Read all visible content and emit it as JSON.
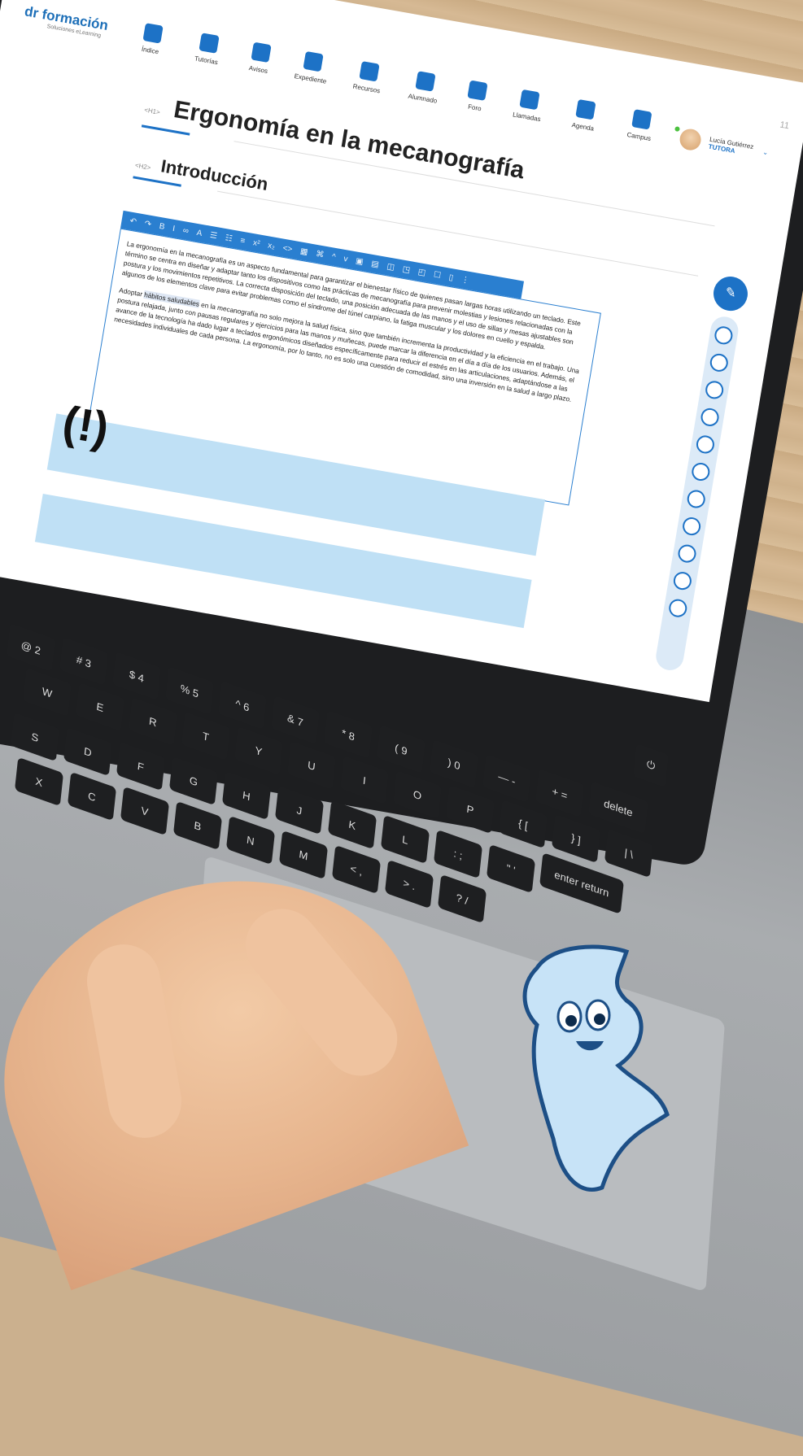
{
  "header": {
    "logo_text": "dr formación",
    "logo_tagline": "Soluciones eLearning",
    "page_number": "11"
  },
  "nav": {
    "items": [
      {
        "label": "Índice",
        "icon": "index-icon"
      },
      {
        "label": "Tutorías",
        "icon": "graduation-cap-icon"
      },
      {
        "label": "Avisos",
        "icon": "flag-icon"
      },
      {
        "label": "Expediente",
        "icon": "document-icon"
      },
      {
        "label": "Recursos",
        "icon": "box-icon"
      },
      {
        "label": "Alumnado",
        "icon": "group-icon"
      },
      {
        "label": "Foro",
        "icon": "chat-bubbles-icon"
      },
      {
        "label": "Llamadas",
        "icon": "headset-icon"
      },
      {
        "label": "Agenda",
        "icon": "calendar-icon"
      },
      {
        "label": "Campus",
        "icon": "exit-door-icon"
      }
    ]
  },
  "user": {
    "name": "Lucía Gutiérrez",
    "role": "TUTORA"
  },
  "content": {
    "title_tag": "<H1>",
    "title": "Ergonomía en la mecanografía",
    "subtitle_tag": "<H2>",
    "subtitle": "Introducción",
    "paragraph1": "La ergonomía en la mecanografía es un aspecto fundamental para garantizar el bienestar físico de quienes pasan largas horas utilizando un teclado. Este término se centra en diseñar y adaptar tanto los dispositivos como las prácticas de mecanografía para prevenir molestias y lesiones relacionadas con la postura y los movimientos repetitivos. La correcta disposición del teclado, una posición adecuada de las manos y el uso de sillas y mesas ajustables son algunos de los elementos clave para evitar problemas como el síndrome del túnel carpiano, la fatiga muscular y los dolores en cuello y espalda.",
    "paragraph2_pre": "Adoptar ",
    "paragraph2_highlight": "hábitos saludables",
    "paragraph2_post": " en la mecanografía no solo mejora la salud física, sino que también incrementa la productividad y la eficiencia en el trabajo. Una postura relajada, junto con pausas regulares y ejercicios para las manos y muñecas, puede marcar la diferencia en el día a día de los usuarios. Además, el avance de la tecnología ha dado lugar a teclados ergonómicos diseñados específicamente para reducir el estrés en las articulaciones, adaptándose a las necesidades individuales de cada persona. La ergonomía, por lo tanto, no es solo una cuestión de comodidad, sino una inversión en la salud a largo plazo.",
    "callout_symbol": "(!)"
  },
  "toolbar": {
    "buttons": [
      "↶",
      "↷",
      "B",
      "I",
      "∞",
      "A",
      "☰",
      "☷",
      "≡",
      "x²",
      "x₂",
      "<>",
      "▦",
      "⌘",
      "^",
      "v",
      "▣",
      "▤",
      "◫",
      "◳",
      "◰",
      "☐",
      "▯",
      "⋮"
    ]
  },
  "sidebar": {
    "icons": [
      "save-icon",
      "paragraph-icon",
      "heading-icon",
      "table-icon",
      "layout-icon",
      "play-icon",
      "music-icon",
      "book-icon",
      "link-icon",
      "media-icon",
      "more-icon"
    ]
  },
  "keyboard": {
    "rows": [
      [
        "@\n2",
        "#\n3",
        "$\n4",
        "%\n5",
        "^\n6",
        "&\n7",
        "*\n8",
        "(\n9",
        ")\n0",
        "—\n-",
        "+\n=",
        "⏻"
      ],
      [
        "W",
        "E",
        "R",
        "T",
        "Y",
        "U",
        "I",
        "O",
        "P",
        "{\n[",
        "}\n]",
        "|\n\\"
      ],
      [
        "S",
        "D",
        "F",
        "G",
        "H",
        "J",
        "K",
        "L",
        ":\n;",
        "\"\n'",
        "enter\nreturn"
      ],
      [
        "X",
        "C",
        "V",
        "B",
        "N",
        "M",
        "<\n,",
        ">\n.",
        "?\n/"
      ]
    ],
    "delete_label": "delete",
    "enter_label": "enter",
    "return_label": "return"
  },
  "colors": {
    "accent": "#1d72c6",
    "callout_bg": "#bfe0f5",
    "online_dot": "#4cc13f"
  }
}
